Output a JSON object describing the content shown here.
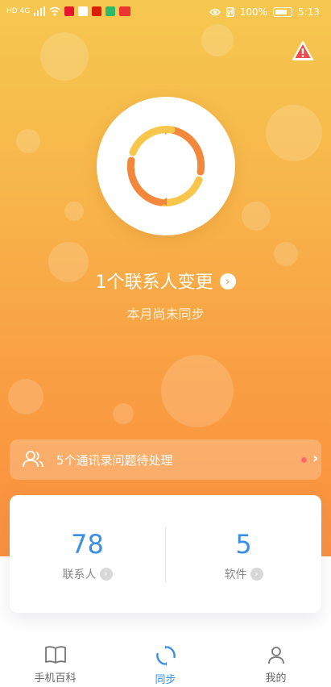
{
  "status_bar": {
    "left_label": "HD 4G",
    "battery": "100%",
    "time": "5:13",
    "left_icons": [
      "signal-icon",
      "wifi-icon",
      "weibo-icon",
      "app-icon",
      "app-icon",
      "play-icon",
      "news-icon"
    ],
    "right_icons": [
      "eye-icon",
      "nfc-icon",
      "battery-icon"
    ]
  },
  "hero": {
    "headline": "1个联系人变更",
    "subline": "本月尚未同步",
    "colors": {
      "gradient_top": "#f6c84f",
      "gradient_bottom": "#fa8f3d",
      "ring_orange": "#f3883c",
      "ring_yellow": "#f8c64a"
    }
  },
  "issue_bar": {
    "text": "5个通讯录问题待处理",
    "dot_color": "#ff6b6b"
  },
  "stats": [
    {
      "value": "78",
      "label": "联系人"
    },
    {
      "value": "5",
      "label": "软件"
    }
  ],
  "tabs": [
    {
      "label": "手机百科",
      "icon": "book-icon",
      "active": false
    },
    {
      "label": "同步",
      "icon": "sync-icon",
      "active": true
    },
    {
      "label": "我的",
      "icon": "user-icon",
      "active": false
    }
  ],
  "accent": "#3a8ee6"
}
